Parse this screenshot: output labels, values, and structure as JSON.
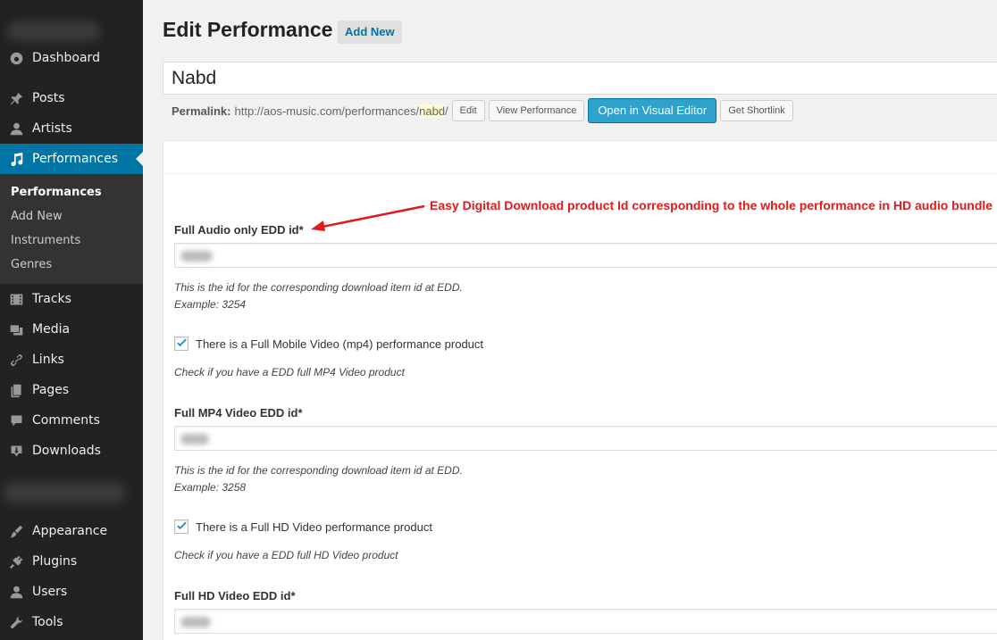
{
  "sidebar": {
    "items": [
      {
        "label": "Dashboard",
        "icon": "dashboard-icon"
      },
      {
        "label": "Posts",
        "icon": "pin-icon"
      },
      {
        "label": "Artists",
        "icon": "user-icon"
      },
      {
        "label": "Performances",
        "icon": "music-icon",
        "active": true
      },
      {
        "label": "Tracks",
        "icon": "film-icon"
      },
      {
        "label": "Media",
        "icon": "media-icon"
      },
      {
        "label": "Links",
        "icon": "link-icon"
      },
      {
        "label": "Pages",
        "icon": "pages-icon"
      },
      {
        "label": "Comments",
        "icon": "comment-icon"
      },
      {
        "label": "Downloads",
        "icon": "download-icon"
      },
      {
        "label": "Appearance",
        "icon": "brush-icon"
      },
      {
        "label": "Plugins",
        "icon": "plugin-icon"
      },
      {
        "label": "Users",
        "icon": "users-icon"
      },
      {
        "label": "Tools",
        "icon": "wrench-icon"
      }
    ],
    "submenu": [
      "Performances",
      "Add New",
      "Instruments",
      "Genres"
    ]
  },
  "header": {
    "title": "Edit Performance",
    "add_new": "Add New"
  },
  "post": {
    "title": "Nabd",
    "permalink_label": "Permalink:",
    "permalink_base": "http://aos-music.com/performances/",
    "permalink_slug": "nabd",
    "permalink_end": "/",
    "buttons": {
      "edit": "Edit",
      "view": "View Performance",
      "visual_editor": "Open in Visual Editor",
      "shortlink": "Get Shortlink"
    }
  },
  "annotation": "Easy Digital Download product Id corresponding to the whole performance in HD audio bundle",
  "fields": {
    "audio": {
      "label": "Full Audio only EDD id*",
      "desc1": "This is the id for the corresponding download item id at EDD.",
      "desc2": "Example: 3254"
    },
    "mobile_check": {
      "label": "There is a Full Mobile Video (mp4) performance product",
      "desc": "Check if you have a EDD full MP4 Video product",
      "checked": true
    },
    "mp4": {
      "label": "Full MP4 Video EDD id*",
      "desc1": "This is the id for the corresponding download item id at EDD.",
      "desc2": "Example: 3258"
    },
    "hd_check": {
      "label": "There is a Full HD Video performance product",
      "desc": "Check if you have a EDD full HD Video product",
      "checked": true
    },
    "hd": {
      "label": "Full HD Video EDD id*"
    }
  },
  "colors": {
    "sidebar_bg": "#222222",
    "active_bg": "#0074a2",
    "primary_btn": "#2ea2cc",
    "annotation": "#e01b1b"
  }
}
